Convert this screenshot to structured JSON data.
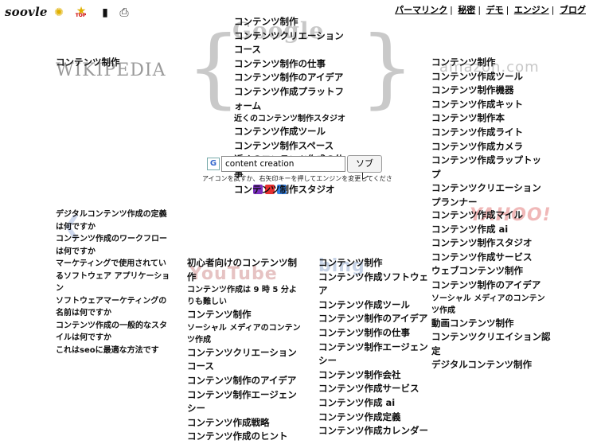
{
  "header": {
    "logo_text": "soovle",
    "icons": [
      "sparkle-icon",
      "star-icon",
      "book-icon",
      "printer-icon"
    ],
    "top_badge": "TOP",
    "links": [
      "パーマリンク",
      "秘密",
      "デモ",
      "エンジン",
      "ブログ"
    ]
  },
  "search": {
    "value": "content creation",
    "button_label": "ソブレ",
    "hint": "アイコンを試すか、右矢印キーを押してエンジンを変更してくださ"
  },
  "wikipedia": {
    "logo_text": "WIKIPEDIA",
    "items": [
      "コンテンツ制作"
    ]
  },
  "google": {
    "logo_text": "Google",
    "items": [
      "コンテンツ制作",
      "コンテンツクリエーション コース",
      "コンテンツ制作の仕事",
      "コンテンツ制作のアイデア",
      "コンテンツ作成プラットフォーム",
      "近くのコンテンツ制作スタジオ",
      "コンテンツ作成ツール",
      "コンテンツ制作スペース",
      "近くのコンテンツ作成の仕事",
      "コンテンツ制作スタジオ"
    ]
  },
  "amazon": {
    "logo_text": "amazon.com",
    "items": [
      "コンテンツ制作",
      "コンテンツ作成ツール",
      "コンテンツ制作機器",
      "コンテンツ作成キット",
      "コンテンツ制作本",
      "コンテンツ作成ライト",
      "コンテンツ作成カメラ",
      "コンテンツ作成ラップトップ",
      "コンテンツクリエーション プランナー"
    ]
  },
  "yahoo": {
    "logo_text": "YAHOO!",
    "items": [
      "コンテンツ作成マイル",
      "コンテンツ作成 ai",
      "コンテンツ制作スタジオ",
      "コンテンツ作成サービス",
      "ウェブコンテンツ制作",
      "コンテンツ制作のアイデア",
      "ソーシャル メディアのコンテンツ作成",
      "動画コンテンツ制作",
      "コンテンツクリエイション認定",
      "デジタルコンテンツ制作"
    ]
  },
  "answers": {
    "items": [
      "デジタルコンテンツ作成の定義は何ですか",
      "コンテンツ作成のワークフローは何ですか",
      "マーケティングで使用されているソフトウェア アプリケーション",
      "ソフトウェアマーケティングの名前は何ですか",
      "コンテンツ作成の一般的なスタイルは何ですか",
      "これはseoに最適な方法です"
    ]
  },
  "youtube": {
    "logo_text": "YouTube",
    "items": [
      "初心者向けのコンテンツ制作",
      "コンテンツ作成は 9 時 5 分よりも難しい",
      "コンテンツ制作",
      "ソーシャル メディアのコンテンツ作成",
      "コンテンツクリエーション コース",
      "コンテンツ制作のアイデア",
      "コンテンツ制作エージェンシー",
      "コンテンツ作成戦略",
      "コンテンツ作成のヒント"
    ]
  },
  "bing": {
    "logo_text": "bing",
    "items": [
      "コンテンツ制作",
      "コンテンツ作成ソフトウェア",
      "コンテンツ作成ツール",
      "コンテンツ制作のアイデア",
      "コンテンツ制作の仕事",
      "コンテンツ制作エージェンシー",
      "コンテンツ制作会社",
      "コンテンツ作成サービス",
      "コンテンツ作成 ai",
      "コンテンツ作成定義",
      "コンテンツ作成カレンダー"
    ]
  },
  "colors": {
    "ghost": "#c8c8c8",
    "link": "#111111",
    "brace": "#c9c9c9"
  }
}
